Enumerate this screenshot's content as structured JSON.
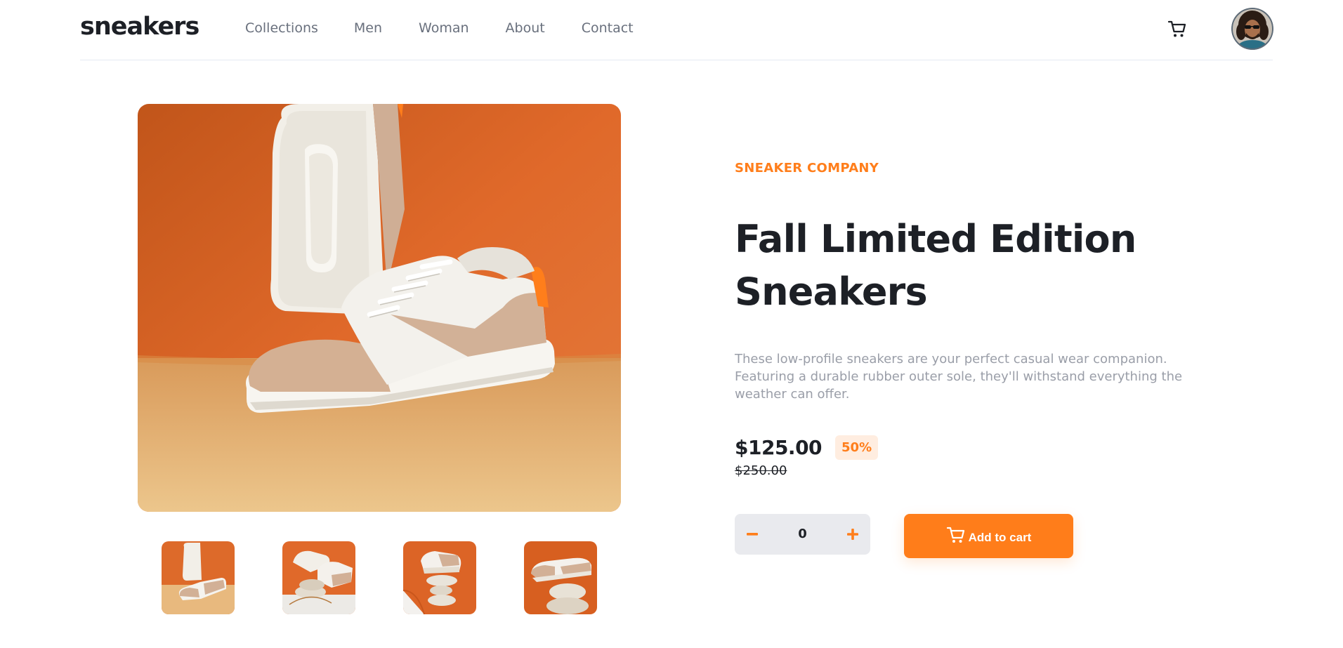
{
  "brand": {
    "logo": "sneakers"
  },
  "nav": {
    "items": [
      "Collections",
      "Men",
      "Woman",
      "About",
      "Contact"
    ]
  },
  "header": {
    "cart_icon": "cart-icon",
    "avatar_icon": "user-avatar"
  },
  "product": {
    "company": "SNEAKER COMPANY",
    "title_line1": "Fall Limited Edition",
    "title_line2": "Sneakers",
    "description": "These low-profile sneakers are your perfect casual wear companion. Featuring a durable rubber outer sole, they'll withstand everything the weather can offer.",
    "price": "$125.00",
    "discount": "50%",
    "original_price": "$250.00"
  },
  "cart": {
    "quantity": "0",
    "minus_icon": "minus-icon",
    "plus_icon": "plus-icon",
    "add_label": "Add to cart"
  },
  "colors": {
    "accent": "#ff7e1b",
    "accent_light": "#ffede0",
    "text_dark": "#1d2026",
    "text_gray": "#69707d",
    "qty_bg": "#e9eaee"
  },
  "gallery": {
    "main": "product-photo-1",
    "thumbnails": [
      "product-thumbnail-1",
      "product-thumbnail-2",
      "product-thumbnail-3",
      "product-thumbnail-4"
    ]
  }
}
